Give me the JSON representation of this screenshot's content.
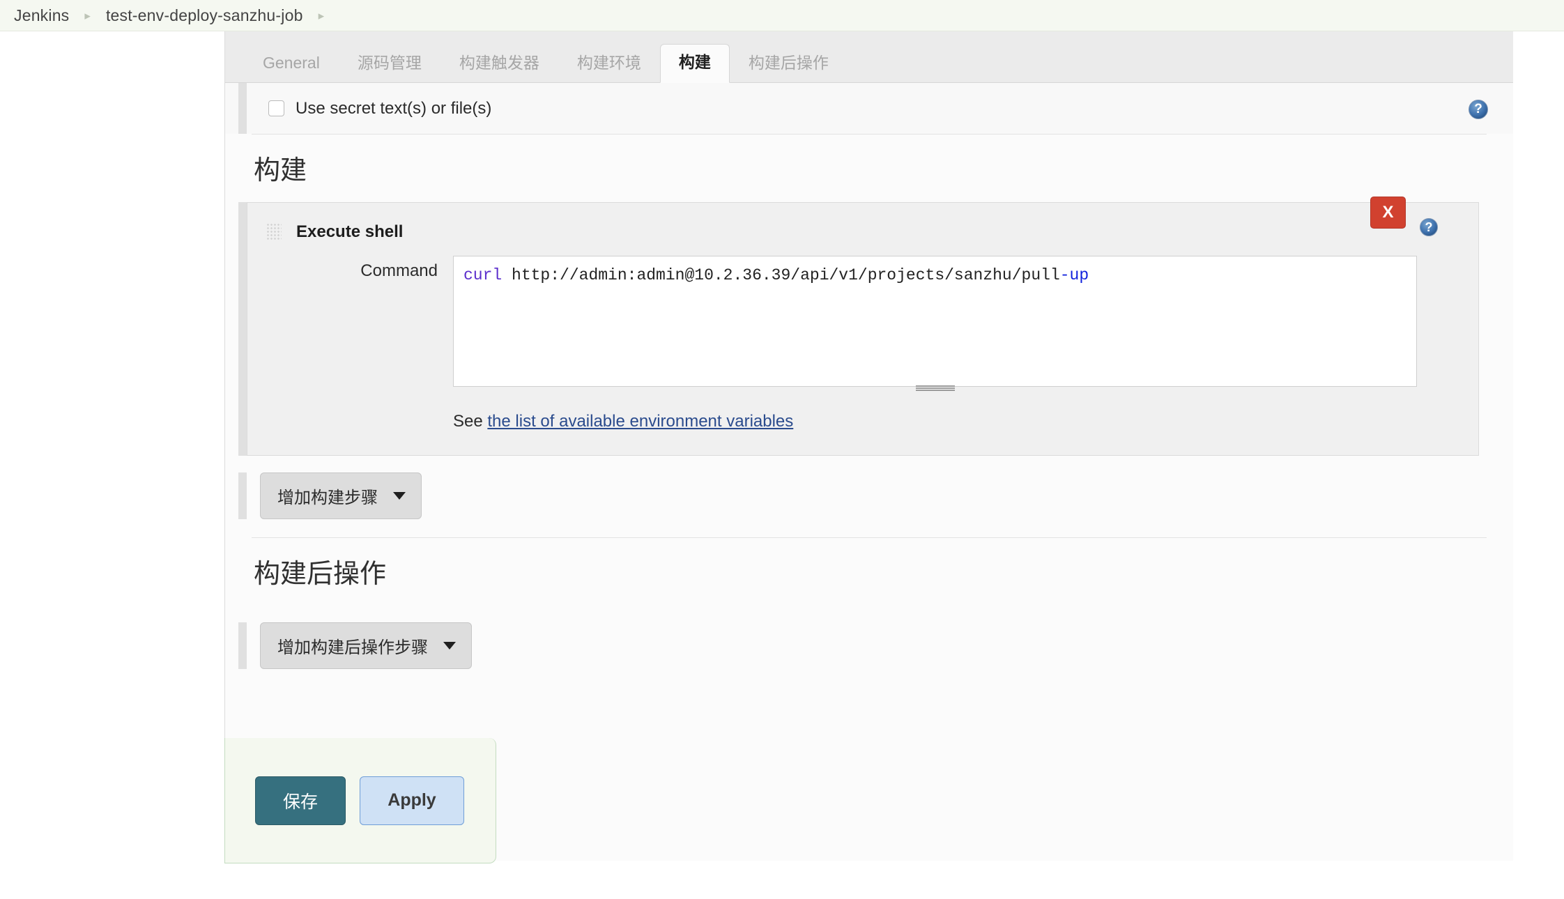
{
  "breadcrumb": {
    "items": [
      "Jenkins",
      "test-env-deploy-sanzhu-job"
    ],
    "separator": "▸"
  },
  "tabs": [
    {
      "label": "General",
      "active": false
    },
    {
      "label": "源码管理",
      "active": false
    },
    {
      "label": "构建触发器",
      "active": false
    },
    {
      "label": "构建环境",
      "active": false
    },
    {
      "label": "构建",
      "active": true
    },
    {
      "label": "构建后操作",
      "active": false
    }
  ],
  "build_env": {
    "secret_checkbox_label": "Use secret text(s) or file(s)",
    "secret_checked": false,
    "help_glyph": "?"
  },
  "build_section": {
    "heading": "构建",
    "step": {
      "title": "Execute shell",
      "delete_label": "X",
      "help_glyph": "?",
      "command_label": "Command",
      "command_tokens": [
        {
          "text": "curl",
          "kind": "keyword"
        },
        {
          "text": " http://admin:admin@10.2.36.39/api/v1/projects/sanzhu/pull",
          "kind": "plain"
        },
        {
          "text": "-up",
          "kind": "option"
        }
      ],
      "command_value": "curl http://admin:admin@10.2.36.39/api/v1/projects/sanzhu/pull-up",
      "see_prefix": "See",
      "see_link_text": "the list of available environment variables"
    },
    "add_step_button": "增加构建步骤"
  },
  "post_build_section": {
    "heading": "构建后操作",
    "add_step_button": "增加构建后操作步骤"
  },
  "save_bar": {
    "save_label": "保存",
    "apply_label": "Apply"
  },
  "colors": {
    "breadcrumb_bg": "#f5f8f1",
    "tab_active_bg": "#fbfbfb",
    "delete_red": "#d1412f",
    "save_teal": "#36707f",
    "apply_blue": "#cfe1f5",
    "link_blue": "#2a4b8d",
    "keyword_purple": "#5b2ecc",
    "option_blue": "#1122dd"
  }
}
